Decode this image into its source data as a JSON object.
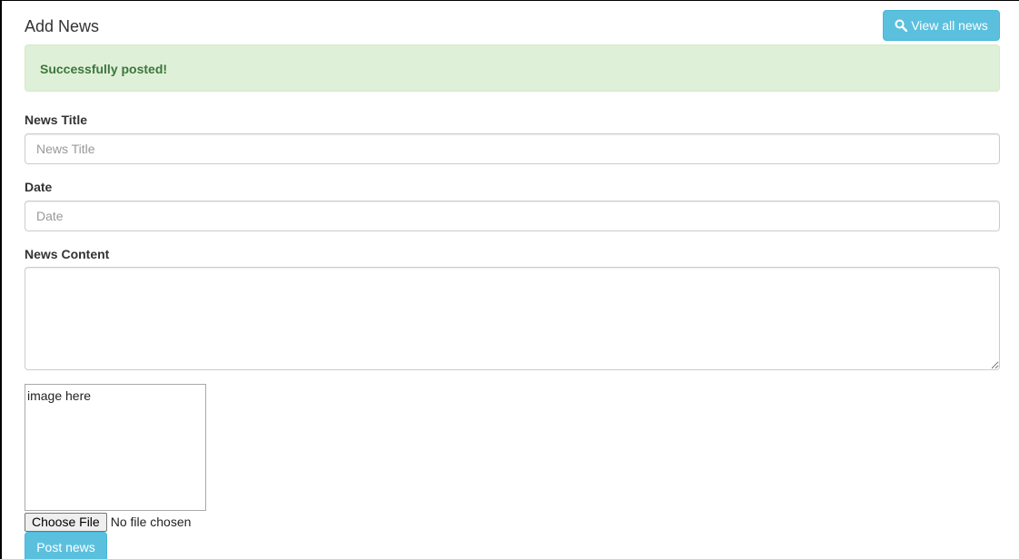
{
  "header": {
    "title": "Add News",
    "view_all_label": "View all news",
    "view_all_icon": "search-icon"
  },
  "alert": {
    "message": "Successfully posted!",
    "color": "#3c763d",
    "background": "#dff0d8"
  },
  "form": {
    "title_label": "News Title",
    "title_placeholder": "News Title",
    "title_value": "",
    "date_label": "Date",
    "date_placeholder": "Date",
    "date_value": "",
    "content_label": "News Content",
    "content_value": "",
    "image_preview_text": "image here",
    "file_button_label": "Choose File",
    "file_status": "No file chosen",
    "submit_label": "Post news"
  },
  "colors": {
    "accent": "#5bc0de"
  }
}
